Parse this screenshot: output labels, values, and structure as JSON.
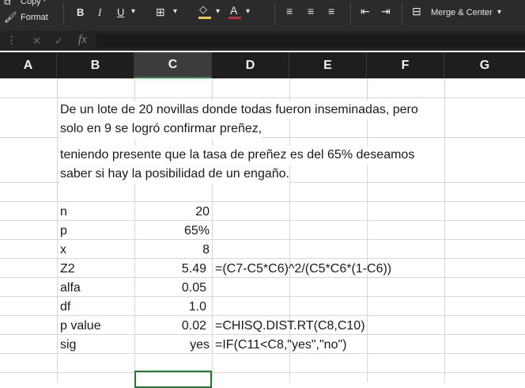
{
  "ribbon": {
    "copy_label": "Copy",
    "format_label": "Format",
    "bold_label": "B",
    "italic_label": "I",
    "underline_label": "U",
    "fontcolor_label": "A",
    "merge_label": "Merge & Center",
    "fill_color": "#f5d400",
    "font_color": "#e02020"
  },
  "formula_bar": {
    "fx_label": "fx",
    "cancel_icon": "✕",
    "confirm_icon": "✓",
    "value": ""
  },
  "columns": [
    "A",
    "B",
    "C",
    "D",
    "E",
    "F",
    "G"
  ],
  "selected_column": "C",
  "paragraphs": [
    "De un lote de 20 novillas donde todas fueron inseminadas, pero",
    "solo en 9 se logró confirmar preñez,",
    "teniendo presente que la tasa de preñez  es del 65% deseamos",
    "saber si hay la posibilidad de un engaño."
  ],
  "rows": [
    {
      "label": "n",
      "value": "20",
      "formula": ""
    },
    {
      "label": "p",
      "value": "65%",
      "formula": ""
    },
    {
      "label": "x",
      "value": "8",
      "formula": ""
    },
    {
      "label": "Z2",
      "value": "5.49",
      "formula": "=(C7-C5*C6)^2/(C5*C6*(1-C6))"
    },
    {
      "label": "alfa",
      "value": "0.05",
      "formula": ""
    },
    {
      "label": "df",
      "value": "1.0",
      "formula": ""
    },
    {
      "label": "p value",
      "value": "0.02",
      "formula": "=CHISQ.DIST.RT(C8,C10)"
    },
    {
      "label": "sig",
      "value": "yes",
      "formula": "=IF(C11<C8,\"yes\",\"no\")"
    }
  ]
}
